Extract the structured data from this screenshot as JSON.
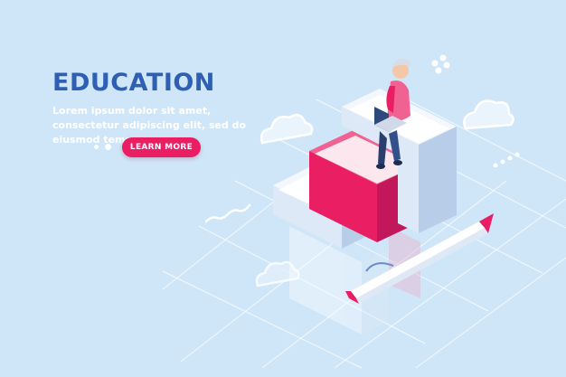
{
  "hero": {
    "title": "EDUCATION",
    "description": "Lorem ipsum dolor sit amet, consectetur adipiscing elit, sed do eiusmod tempor",
    "cta_label": "LEARN MORE"
  },
  "colors": {
    "background": "#cfe6f8",
    "accent": "#e91e63",
    "title": "#2f5fb3"
  },
  "carousel": {
    "dot_count": 2
  }
}
